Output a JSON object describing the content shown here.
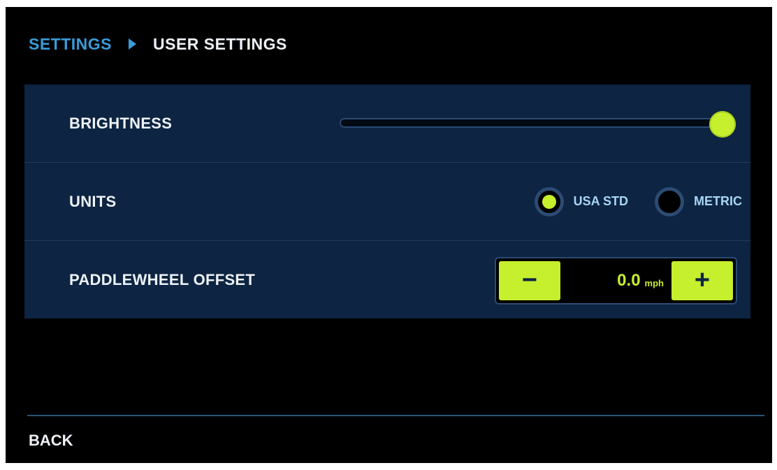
{
  "breadcrumb": {
    "root": "SETTINGS",
    "current": "USER SETTINGS"
  },
  "settings": {
    "brightness": {
      "label": "BRIGHTNESS",
      "level": 1.0
    },
    "units": {
      "label": "UNITS",
      "options": [
        {
          "label": "USA STD",
          "selected": true
        },
        {
          "label": "METRIC",
          "selected": false
        }
      ]
    },
    "paddlewheel_offset": {
      "label": "PADDLEWHEEL OFFSET",
      "value": "0.0",
      "unit": "mph",
      "minus_label": "−",
      "plus_label": "+"
    }
  },
  "footer": {
    "back_label": "BACK"
  },
  "colors": {
    "accent": "#c6ef2e",
    "breadcrumb_root": "#3a9bd9",
    "panel": "#0d2442"
  },
  "icons": {
    "breadcrumb_separator": "chevron-right-icon"
  }
}
